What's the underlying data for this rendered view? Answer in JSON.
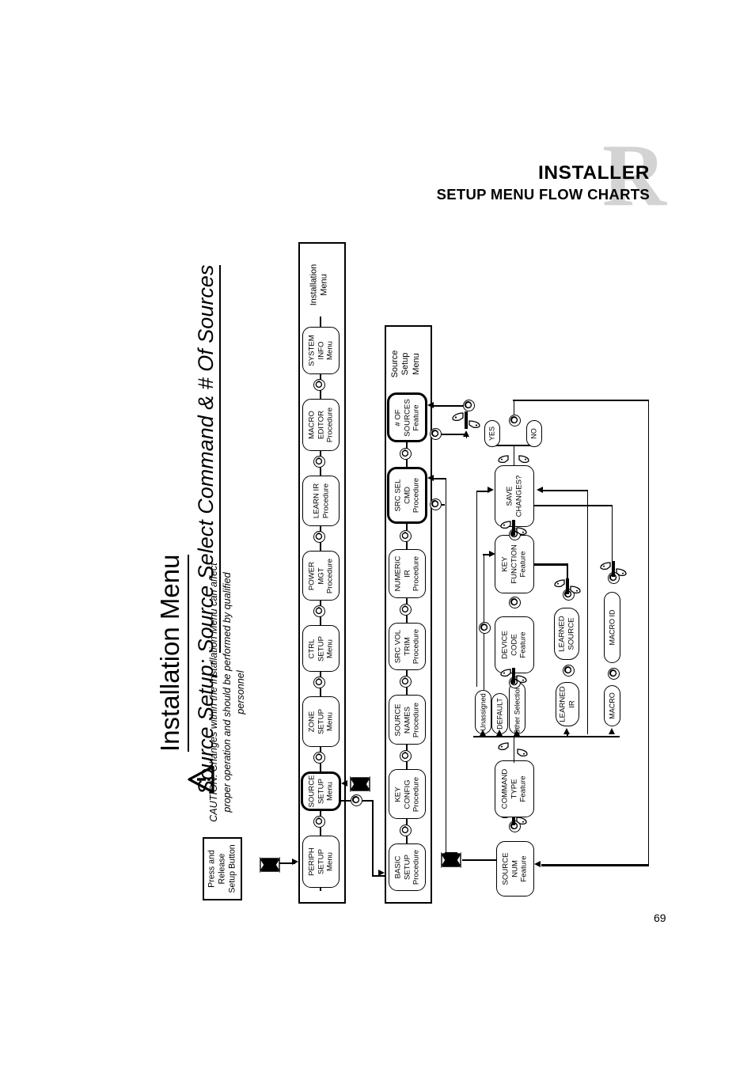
{
  "page": {
    "number": "69",
    "header": {
      "line1": "INSTALLER",
      "line2": "SETUP MENU FLOW CHARTS",
      "brand_watermark": "R"
    },
    "title": {
      "main": "Installation Menu",
      "sub_prefix": "Source Setup: ",
      "sub_emphasis": "Source Select Command & # Of Sources"
    },
    "caution": {
      "icon": "warning-triangle-icon",
      "text": "CAUTION: Changes within the Installation Menu can affect proper operation and should be performed by qualified personnel"
    },
    "start": {
      "label": "Press and\nRelease\nSetup Button",
      "line1": "Press and",
      "line2": "Release",
      "line3": "Setup Button"
    }
  },
  "chart_data": {
    "type": "diagram",
    "title": "Installation Menu - Source Setup: Source Select Command & # Of Sources",
    "columns": [
      {
        "id": "installation-menu",
        "title": "Installation\nMenu",
        "title_line1": "Installation",
        "title_line2": "Menu",
        "nodes": [
          {
            "id": "periph-setup",
            "line1": "PERIPH",
            "line2": "SETUP",
            "line3": "Menu",
            "emphasis": false
          },
          {
            "id": "source-setup",
            "line1": "SOURCE",
            "line2": "SETUP",
            "line3": "Menu",
            "emphasis": true
          },
          {
            "id": "zone-setup",
            "line1": "ZONE",
            "line2": "SETUP",
            "line3": "Menu",
            "emphasis": false
          },
          {
            "id": "ctrl-setup",
            "line1": "CTRL",
            "line2": "SETUP",
            "line3": "Menu",
            "emphasis": false
          },
          {
            "id": "power-mgt",
            "line1": "POWER",
            "line2": "MGT",
            "line3": "Procedure",
            "emphasis": false
          },
          {
            "id": "learn-ir",
            "line1": "LEARN IR",
            "line2": "",
            "line3": "Procedure",
            "emphasis": false
          },
          {
            "id": "macro-editor",
            "line1": "MACRO",
            "line2": "EDITOR",
            "line3": "Procedure",
            "emphasis": false
          },
          {
            "id": "system-info",
            "line1": "SYSTEM",
            "line2": "INFO",
            "line3": "Menu",
            "emphasis": false
          }
        ]
      },
      {
        "id": "source-setup-menu",
        "title": "Source\nSetup\nMenu",
        "title_line1": "Source",
        "title_line2": "Setup",
        "title_line3": "Menu",
        "nodes": [
          {
            "id": "basic-setup",
            "line1": "BASIC",
            "line2": "SETUP",
            "line3": "Procedure",
            "emphasis": false
          },
          {
            "id": "key-config",
            "line1": "KEY",
            "line2": "CONFIG",
            "line3": "Procedure",
            "emphasis": false
          },
          {
            "id": "source-names",
            "line1": "SOURCE",
            "line2": "NAMES",
            "line3": "Procedure",
            "emphasis": false
          },
          {
            "id": "src-vol-trim",
            "line1": "SRC VOL",
            "line2": "TRIM",
            "line3": "Procedure",
            "emphasis": false
          },
          {
            "id": "numeric-ir",
            "line1": "NUMERIC",
            "line2": "IR",
            "line3": "Procedure",
            "emphasis": false
          },
          {
            "id": "src-sel-cmd",
            "line1": "SRC SEL",
            "line2": "CMD",
            "line3": "Procedure",
            "emphasis": true
          },
          {
            "id": "num-of-sources",
            "line1": "# OF",
            "line2": "SOURCES",
            "line3": "Feature",
            "emphasis": true
          }
        ]
      }
    ],
    "detail_flow": {
      "nodes": [
        {
          "id": "source-num",
          "line1": "SOURCE",
          "line2": "NUM",
          "line3": "Feature",
          "shape": "rounded"
        },
        {
          "id": "command-type",
          "line1": "COMMAND",
          "line2": "TYPE",
          "line3": "Feature",
          "shape": "rounded"
        },
        {
          "id": "device-code",
          "line1": "DEVICE",
          "line2": "CODE",
          "line3": "Feature",
          "shape": "rounded"
        },
        {
          "id": "key-function",
          "line1": "KEY",
          "line2": "FUNCTION",
          "line3": "Feature",
          "shape": "rounded"
        },
        {
          "id": "save-changes",
          "line1": "SAVE",
          "line2": "CHANGES?",
          "line3": "",
          "shape": "rounded"
        },
        {
          "id": "learned-source",
          "line1": "LEARNED",
          "line2": "SOURCE",
          "line3": "",
          "shape": "pill"
        },
        {
          "id": "learned-ir",
          "line1": "LEARNED",
          "line2": "IR",
          "line3": "",
          "shape": "pill"
        },
        {
          "id": "macro-id",
          "line1": "MACRO ID",
          "line2": "",
          "line3": "",
          "shape": "pill"
        },
        {
          "id": "macro",
          "line1": "MACRO",
          "line2": "",
          "line3": "",
          "shape": "pill"
        },
        {
          "id": "unassigned",
          "line1": "Unassigned",
          "line2": "",
          "line3": "",
          "shape": "pill"
        },
        {
          "id": "default",
          "line1": "DEFAULT",
          "line2": "",
          "line3": "",
          "shape": "pill"
        },
        {
          "id": "other-selections",
          "line1": "Other Selections",
          "line2": "",
          "line3": "",
          "shape": "pill"
        },
        {
          "id": "yes",
          "line1": "YES",
          "line2": "",
          "line3": "",
          "shape": "pill"
        },
        {
          "id": "no",
          "line1": "NO",
          "line2": "",
          "line3": "",
          "shape": "pill"
        }
      ]
    }
  }
}
